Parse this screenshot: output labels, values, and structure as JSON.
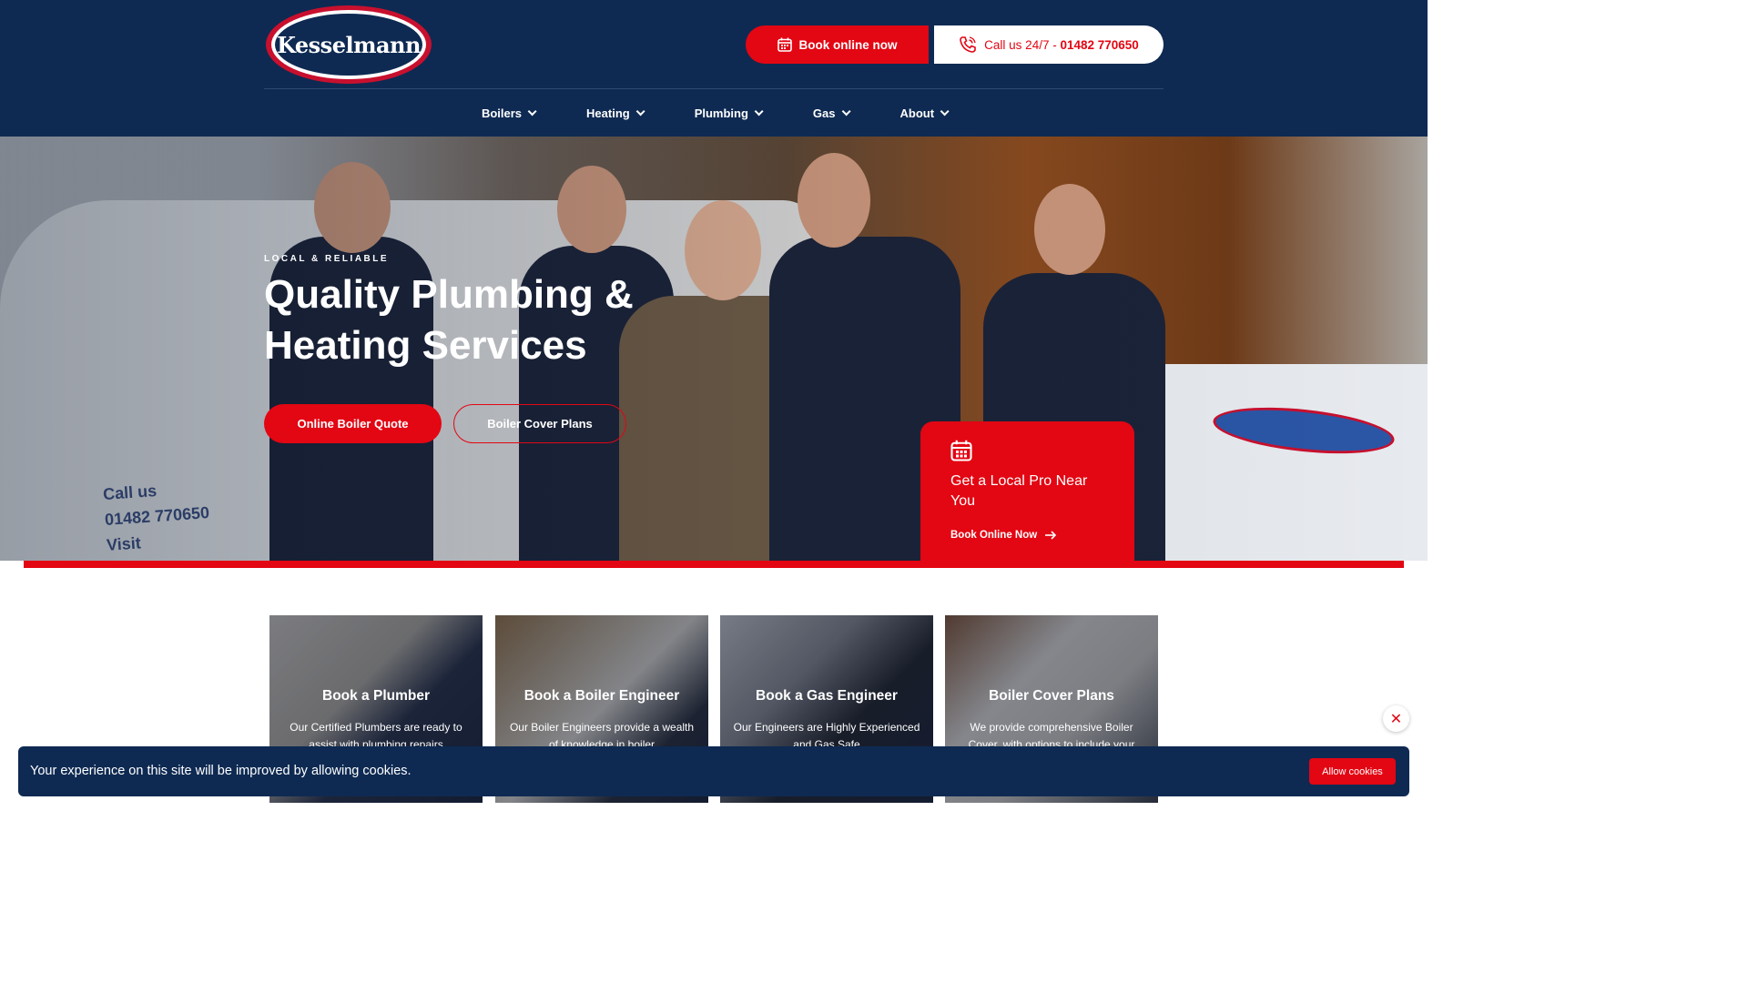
{
  "brand": {
    "logo_text": "Kesselmann"
  },
  "header": {
    "book_label": "Book online now",
    "call_prefix": "Call us 24/7 - ",
    "call_number": "01482 770650"
  },
  "nav": [
    {
      "label": "Boilers"
    },
    {
      "label": "Heating"
    },
    {
      "label": "Plumbing"
    },
    {
      "label": "Gas"
    },
    {
      "label": "About"
    }
  ],
  "hero": {
    "eyebrow": "LOCAL & RELIABLE",
    "title": "Quality Plumbing & Heating Services",
    "primary_cta": "Online Boiler Quote",
    "secondary_cta": "Boiler Cover Plans",
    "van_text": [
      "Call us",
      "01482 770650",
      "Visit"
    ]
  },
  "pro_card": {
    "title": "Get a Local Pro Near You",
    "link": "Book Online Now"
  },
  "cards": [
    {
      "title": "Book a Plumber",
      "desc": "Our Certified Plumbers are ready to assist with plumbing repairs"
    },
    {
      "title": "Book a Boiler Engineer",
      "desc": "Our Boiler Engineers provide a wealth of knowledge in boiler"
    },
    {
      "title": "Book a Gas Engineer",
      "desc": "Our Engineers are Highly Experienced and Gas Safe"
    },
    {
      "title": "Boiler Cover Plans",
      "desc": "We provide comprehensive Boiler Cover, with options to include your"
    }
  ],
  "cookie": {
    "text": "Your experience on this site will be improved by allowing cookies.",
    "button": "Allow cookies",
    "close_symbol": "✕"
  },
  "colors": {
    "navy": "#0e2a52",
    "red": "#e30613",
    "white": "#ffffff"
  },
  "icons": [
    "calendar-icon",
    "phone-icon",
    "chevron-down-icon",
    "arrow-right-icon",
    "close-icon"
  ]
}
